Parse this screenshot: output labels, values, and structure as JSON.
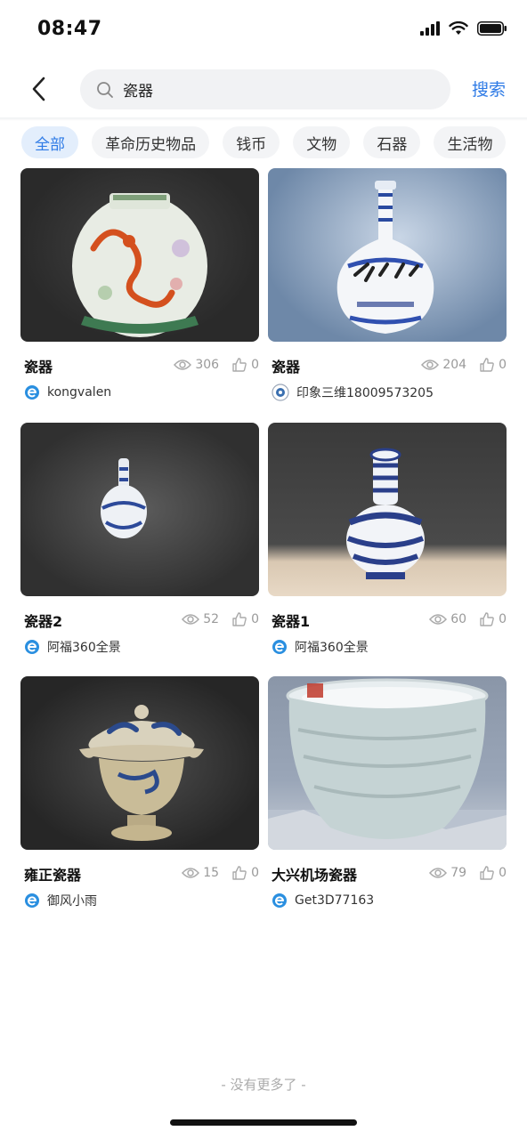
{
  "status": {
    "time": "08:47"
  },
  "header": {
    "search_value": "瓷器",
    "search_button": "搜索"
  },
  "tabs": [
    {
      "label": "全部",
      "active": true
    },
    {
      "label": "革命历史物品",
      "active": false
    },
    {
      "label": "钱币",
      "active": false
    },
    {
      "label": "文物",
      "active": false
    },
    {
      "label": "石器",
      "active": false
    },
    {
      "label": "生活物",
      "active": false
    }
  ],
  "cards": [
    {
      "title": "瓷器",
      "views": "306",
      "likes": "0",
      "author": "kongvalen",
      "avatar_icon": "e-logo-icon"
    },
    {
      "title": "瓷器",
      "views": "204",
      "likes": "0",
      "author": "印象三维18009573205",
      "avatar_icon": "badge-avatar-icon"
    },
    {
      "title": "瓷器2",
      "views": "52",
      "likes": "0",
      "author": "阿福360全景",
      "avatar_icon": "e-logo-icon"
    },
    {
      "title": "瓷器1",
      "views": "60",
      "likes": "0",
      "author": "阿福360全景",
      "avatar_icon": "e-logo-icon"
    },
    {
      "title": "雍正瓷器",
      "views": "15",
      "likes": "0",
      "author": "御风小雨",
      "avatar_icon": "e-logo-icon"
    },
    {
      "title": "大兴机场瓷器",
      "views": "79",
      "likes": "0",
      "author": "Get3D77163",
      "avatar_icon": "e-logo-icon"
    }
  ],
  "footer": {
    "no_more": "- 没有更多了 -"
  },
  "colors": {
    "accent": "#2f7be6",
    "tab_active_bg": "#e3eefc",
    "muted": "#9a9a9a"
  }
}
